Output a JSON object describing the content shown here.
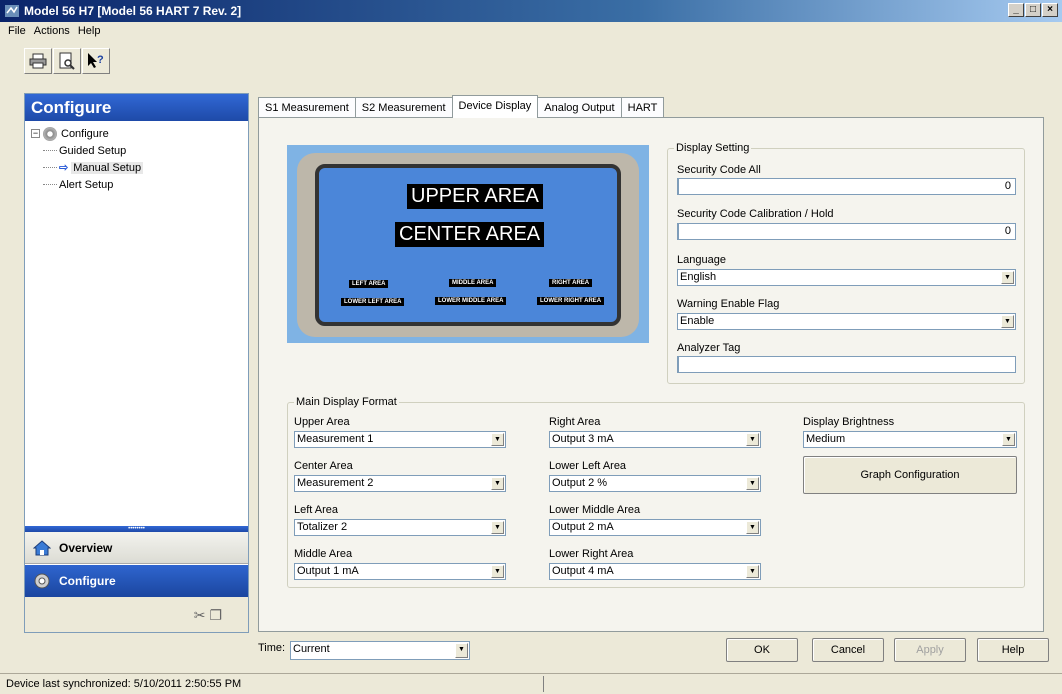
{
  "window": {
    "title": "Model 56 H7 [Model 56 HART 7 Rev. 2]",
    "min": "_",
    "max": "□",
    "close": "×"
  },
  "menu": [
    "File",
    "Actions",
    "Help"
  ],
  "toolbar": {
    "print_icon": "printer-icon",
    "preview_icon": "print-preview-icon",
    "help_icon": "context-help-icon"
  },
  "left": {
    "header": "Configure",
    "tree_root": "Configure",
    "tree_items": [
      "Guided Setup",
      "Manual Setup",
      "Alert Setup"
    ],
    "selected_index": 1,
    "nav_overview": "Overview",
    "nav_configure": "Configure"
  },
  "tabs": [
    "S1 Measurement",
    "S2 Measurement",
    "Device Display",
    "Analog Output",
    "HART"
  ],
  "active_tab": "Device Display",
  "device_image": {
    "upper": "UPPER AREA",
    "center": "CENTER AREA",
    "left": "LEFT AREA",
    "middle": "MIDDLE AREA",
    "right": "RIGHT AREA",
    "lower_left": "LOWER LEFT AREA",
    "lower_middle": "LOWER MIDDLE AREA",
    "lower_right": "LOWER RIGHT AREA"
  },
  "display_setting": {
    "legend": "Display Setting",
    "security_code_all_label": "Security Code All",
    "security_code_all_value": "0",
    "security_code_cal_label": "Security Code Calibration / Hold",
    "security_code_cal_value": "0",
    "language_label": "Language",
    "language_value": "English",
    "warning_label": "Warning Enable Flag",
    "warning_value": "Enable",
    "analyzer_tag_label": "Analyzer Tag",
    "analyzer_tag_value": ""
  },
  "main_display": {
    "legend": "Main Display Format",
    "upper_area_label": "Upper Area",
    "upper_area_value": "Measurement 1",
    "center_area_label": "Center Area",
    "center_area_value": "Measurement 2",
    "left_area_label": "Left Area",
    "left_area_value": "Totalizer 2",
    "middle_area_label": "Middle Area",
    "middle_area_value": "Output 1 mA",
    "right_area_label": "Right Area",
    "right_area_value": "Output 3 mA",
    "lower_left_label": "Lower Left Area",
    "lower_left_value": "Output 2 %",
    "lower_middle_label": "Lower Middle Area",
    "lower_middle_value": "Output 2 mA",
    "lower_right_label": "Lower Right Area",
    "lower_right_value": "Output 4 mA",
    "brightness_label": "Display Brightness",
    "brightness_value": "Medium",
    "graph_button": "Graph Configuration"
  },
  "bottom": {
    "time_label": "Time:",
    "time_value": "Current",
    "ok": "OK",
    "cancel": "Cancel",
    "apply": "Apply",
    "help": "Help"
  },
  "status": "Device last synchronized: 5/10/2011 2:50:55 PM"
}
